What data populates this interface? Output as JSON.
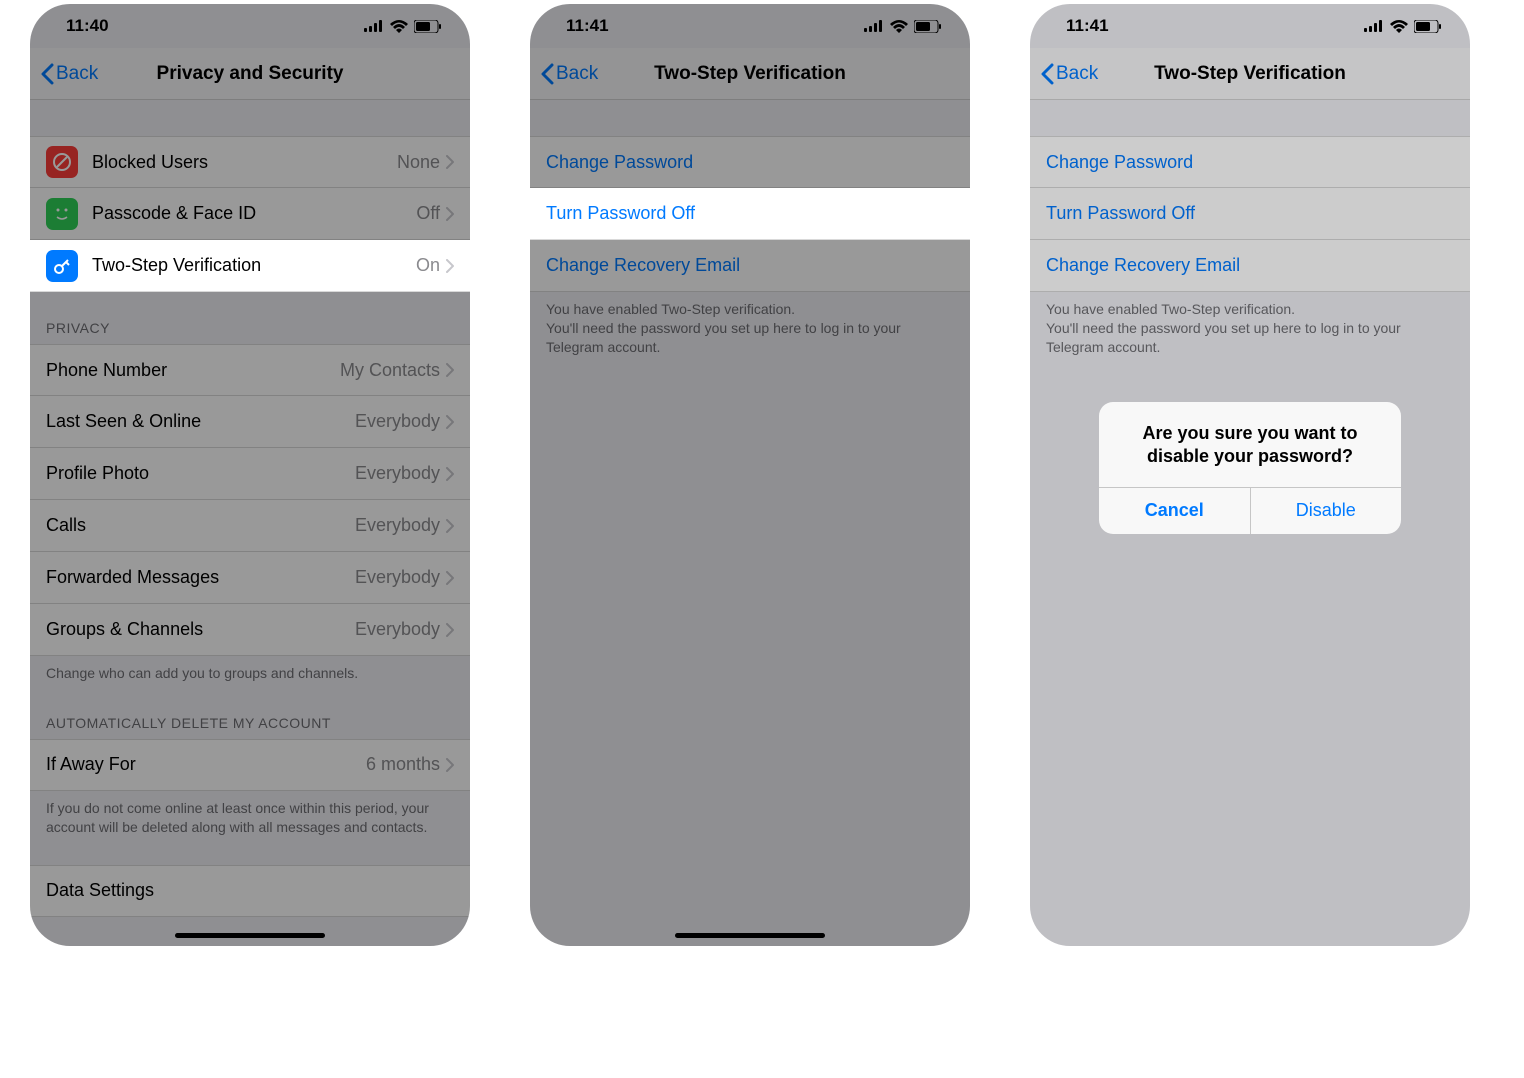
{
  "screen1": {
    "time": "11:40",
    "back_label": "Back",
    "title": "Privacy and Security",
    "security_rows": [
      {
        "label": "Blocked Users",
        "value": "None",
        "icon_name": "blocked-icon",
        "icon_bg": "#fc3d39"
      },
      {
        "label": "Passcode & Face ID",
        "value": "Off",
        "icon_name": "passcode-icon",
        "icon_bg": "#30d158"
      },
      {
        "label": "Two-Step Verification",
        "value": "On",
        "icon_name": "key-icon",
        "icon_bg": "#007aff",
        "highlight": true
      }
    ],
    "privacy_header": "PRIVACY",
    "privacy_rows": [
      {
        "label": "Phone Number",
        "value": "My Contacts"
      },
      {
        "label": "Last Seen & Online",
        "value": "Everybody"
      },
      {
        "label": "Profile Photo",
        "value": "Everybody"
      },
      {
        "label": "Calls",
        "value": "Everybody"
      },
      {
        "label": "Forwarded Messages",
        "value": "Everybody"
      },
      {
        "label": "Groups & Channels",
        "value": "Everybody"
      }
    ],
    "privacy_footer": "Change who can add you to groups and channels.",
    "delete_header": "AUTOMATICALLY DELETE MY ACCOUNT",
    "delete_row": {
      "label": "If Away For",
      "value": "6 months"
    },
    "delete_footer": "If you do not come online at least once within this period, your account will be deleted along with all messages and contacts.",
    "data_settings": "Data Settings"
  },
  "screen2": {
    "time": "11:41",
    "back_label": "Back",
    "title": "Two-Step Verification",
    "rows": [
      {
        "label": "Change Password",
        "name": "change-password"
      },
      {
        "label": "Turn Password Off",
        "name": "turn-password-off",
        "highlight": true
      },
      {
        "label": "Change Recovery Email",
        "name": "change-recovery-email"
      }
    ],
    "footer": "You have enabled Two-Step verification.\nYou'll need the password you set up here to log in to your Telegram account."
  },
  "screen3": {
    "time": "11:41",
    "back_label": "Back",
    "title": "Two-Step Verification",
    "rows": [
      {
        "label": "Change Password",
        "name": "change-password"
      },
      {
        "label": "Turn Password Off",
        "name": "turn-password-off"
      },
      {
        "label": "Change Recovery Email",
        "name": "change-recovery-email"
      }
    ],
    "footer": "You have enabled Two-Step verification.\nYou'll need the password you set up here to log in to your Telegram account.",
    "alert": {
      "message": "Are you sure you want to disable your password?",
      "cancel": "Cancel",
      "confirm": "Disable"
    }
  }
}
